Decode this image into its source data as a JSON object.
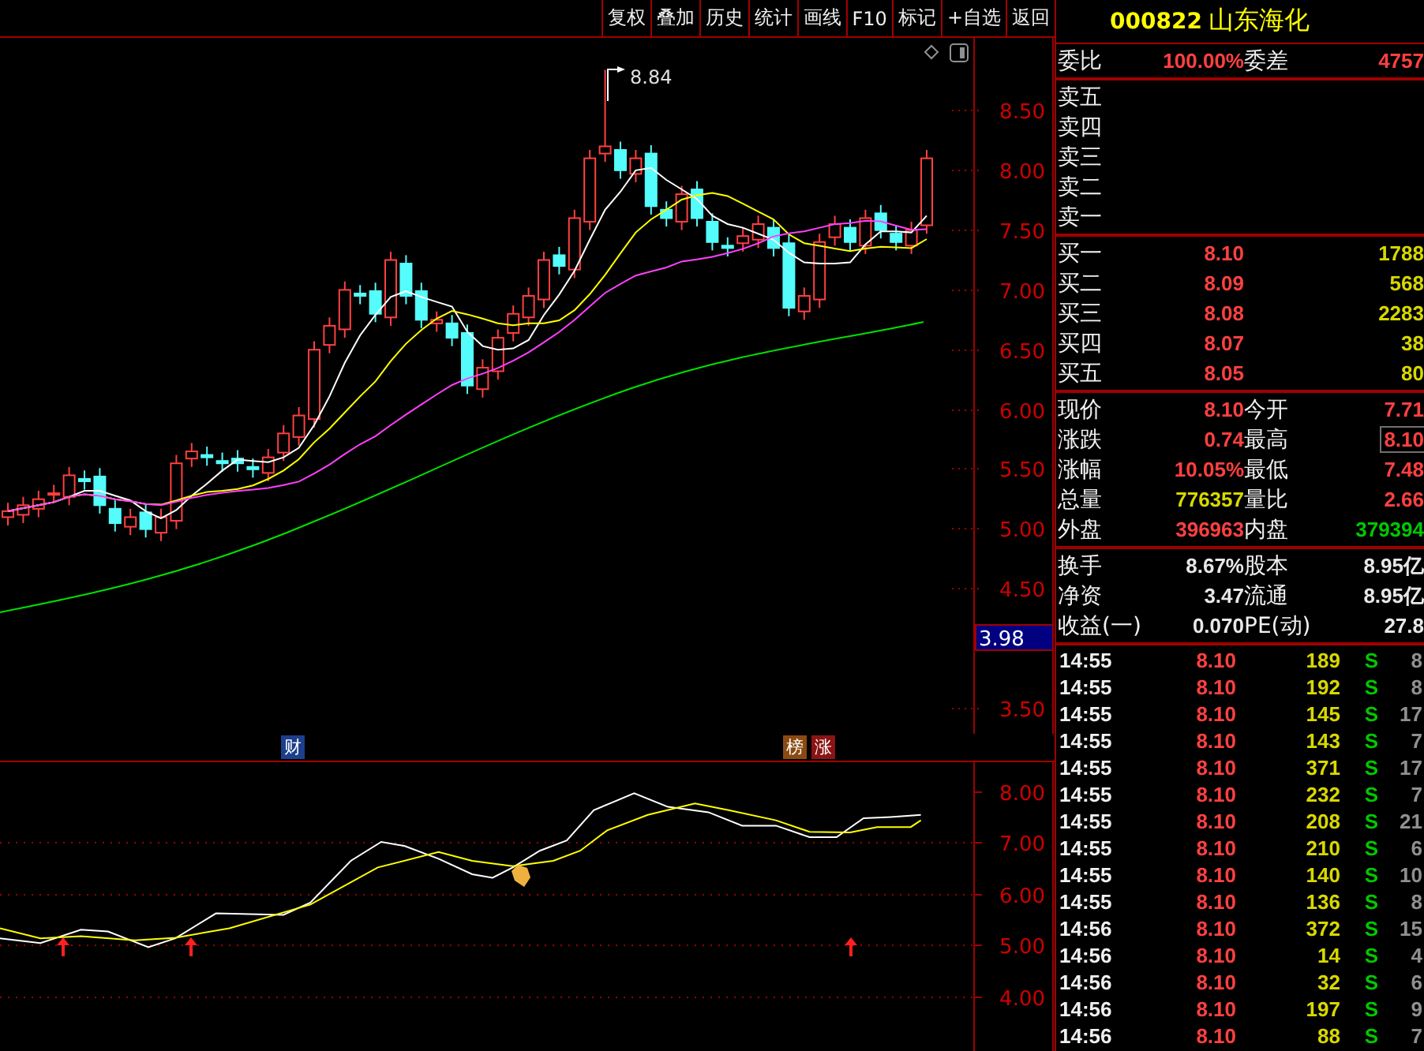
{
  "toolbar": {
    "buttons": [
      "复权",
      "叠加",
      "历史",
      "统计",
      "画线",
      "F10",
      "标记",
      "+自选",
      "返回"
    ]
  },
  "main_chart": {
    "high_label": "8.84",
    "price_axis": [
      "8.50",
      "8.00",
      "7.50",
      "7.00",
      "6.50",
      "6.00",
      "5.50",
      "5.00",
      "4.50",
      "3.50"
    ],
    "price_tag": "3.98"
  },
  "event_markers": [
    {
      "label": "财",
      "color": "#1c3f8c"
    },
    {
      "label": "榜",
      "color": "#8a4a12"
    },
    {
      "label": "涨",
      "color": "#8a1414"
    }
  ],
  "indicator_chart": {
    "axis": [
      "8.00",
      "7.00",
      "6.00",
      "5.00",
      "4.00"
    ]
  },
  "quote": {
    "code": "000822",
    "name": "山东海化",
    "ratio": {
      "label": "委比",
      "value": "100.00%",
      "label2": "委差",
      "value2": "4757"
    },
    "asks": [
      {
        "label": "卖五"
      },
      {
        "label": "卖四"
      },
      {
        "label": "卖三"
      },
      {
        "label": "卖二"
      },
      {
        "label": "卖一"
      }
    ],
    "bids": [
      {
        "label": "买一",
        "price": "8.10",
        "volume": "1788"
      },
      {
        "label": "买二",
        "price": "8.09",
        "volume": "568"
      },
      {
        "label": "买三",
        "price": "8.08",
        "volume": "2283"
      },
      {
        "label": "买四",
        "price": "8.07",
        "volume": "38"
      },
      {
        "label": "买五",
        "price": "8.05",
        "volume": "80"
      }
    ],
    "stats": [
      {
        "cells": [
          {
            "label": "现价",
            "value": "8.10",
            "color": "#ff4040",
            "highlighted": false
          },
          {
            "label": "今开",
            "value": "7.71",
            "color": "#ff4040",
            "highlighted": false
          }
        ]
      },
      {
        "cells": [
          {
            "label": "涨跌",
            "value": "0.74",
            "color": "#ff4040",
            "highlighted": false
          },
          {
            "label": "最高",
            "value": "8.10",
            "color": "#ff4040",
            "highlighted": true
          }
        ]
      },
      {
        "cells": [
          {
            "label": "涨幅",
            "value": "10.05%",
            "color": "#ff4040",
            "highlighted": false
          },
          {
            "label": "最低",
            "value": "7.48",
            "color": "#ff4040",
            "highlighted": false
          }
        ]
      },
      {
        "cells": [
          {
            "label": "总量",
            "value": "776357",
            "color": "#d8d800",
            "highlighted": false
          },
          {
            "label": "量比",
            "value": "2.66",
            "color": "#ff4040",
            "highlighted": false
          }
        ]
      },
      {
        "cells": [
          {
            "label": "外盘",
            "value": "396963",
            "color": "#ff4040",
            "highlighted": false
          },
          {
            "label": "内盘",
            "value": "379394",
            "color": "#00c800",
            "highlighted": false
          }
        ]
      }
    ],
    "fundamentals": [
      {
        "cells": [
          {
            "label": "换手",
            "value": "8.67%",
            "color": "#e8e8e8",
            "highlighted": false
          },
          {
            "label": "股本",
            "value": "8.95亿",
            "color": "#e8e8e8",
            "highlighted": false
          }
        ]
      },
      {
        "cells": [
          {
            "label": "净资",
            "value": "3.47",
            "color": "#e8e8e8",
            "highlighted": false
          },
          {
            "label": "流通",
            "value": "8.95亿",
            "color": "#e8e8e8",
            "highlighted": false
          }
        ]
      },
      {
        "cells": [
          {
            "label": "收益(一)",
            "value": "0.070",
            "color": "#e8e8e8",
            "highlighted": false
          },
          {
            "label": "PE(动)",
            "value": "27.8",
            "color": "#e8e8e8",
            "highlighted": false
          }
        ]
      }
    ],
    "trades": [
      {
        "time": "14:55",
        "price": "8.10",
        "volume": "189",
        "side": "S",
        "count": "8"
      },
      {
        "time": "14:55",
        "price": "8.10",
        "volume": "192",
        "side": "S",
        "count": "8"
      },
      {
        "time": "14:55",
        "price": "8.10",
        "volume": "145",
        "side": "S",
        "count": "17"
      },
      {
        "time": "14:55",
        "price": "8.10",
        "volume": "143",
        "side": "S",
        "count": "7"
      },
      {
        "time": "14:55",
        "price": "8.10",
        "volume": "371",
        "side": "S",
        "count": "17"
      },
      {
        "time": "14:55",
        "price": "8.10",
        "volume": "232",
        "side": "S",
        "count": "7"
      },
      {
        "time": "14:55",
        "price": "8.10",
        "volume": "208",
        "side": "S",
        "count": "21"
      },
      {
        "time": "14:55",
        "price": "8.10",
        "volume": "210",
        "side": "S",
        "count": "6"
      },
      {
        "time": "14:55",
        "price": "8.10",
        "volume": "140",
        "side": "S",
        "count": "10"
      },
      {
        "time": "14:55",
        "price": "8.10",
        "volume": "136",
        "side": "S",
        "count": "8"
      },
      {
        "time": "14:56",
        "price": "8.10",
        "volume": "372",
        "side": "S",
        "count": "15"
      },
      {
        "time": "14:56",
        "price": "8.10",
        "volume": "14",
        "side": "S",
        "count": "4"
      },
      {
        "time": "14:56",
        "price": "8.10",
        "volume": "32",
        "side": "S",
        "count": "6"
      },
      {
        "time": "14:56",
        "price": "8.10",
        "volume": "197",
        "side": "S",
        "count": "9"
      },
      {
        "time": "14:56",
        "price": "8.10",
        "volume": "88",
        "side": "S",
        "count": "7"
      }
    ]
  }
}
